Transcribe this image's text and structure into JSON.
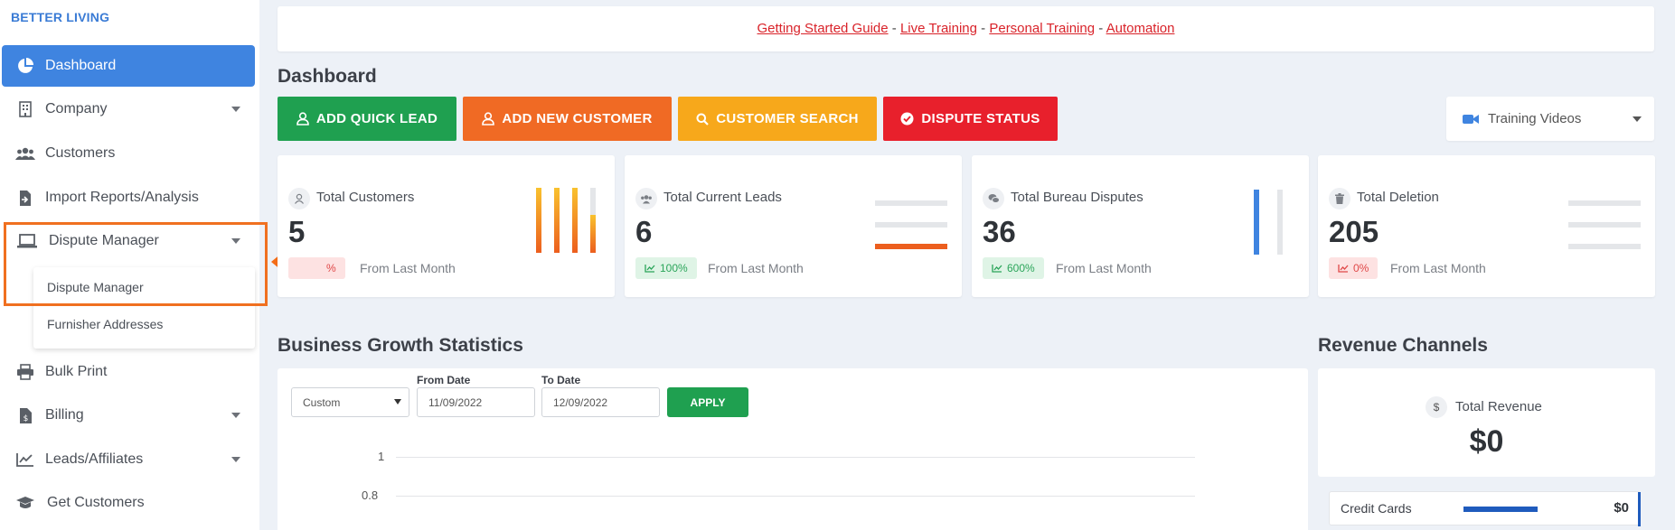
{
  "brand": "BETTER LIVING",
  "sidebar": {
    "items": [
      {
        "label": "Dashboard",
        "icon": "pie-chart-icon"
      },
      {
        "label": "Company",
        "icon": "building-icon"
      },
      {
        "label": "Customers",
        "icon": "users-icon"
      },
      {
        "label": "Import Reports/Analysis",
        "icon": "file-import-icon"
      },
      {
        "label": "Dispute Manager",
        "icon": "laptop-icon"
      },
      {
        "label": "Bulk Print",
        "icon": "printer-icon"
      },
      {
        "label": "Billing",
        "icon": "invoice-icon"
      },
      {
        "label": "Leads/Affiliates",
        "icon": "line-chart-icon"
      },
      {
        "label": "Get Customers",
        "icon": "graduation-cap-icon"
      }
    ],
    "submenu": [
      "Dispute Manager",
      "Furnisher Addresses"
    ]
  },
  "banner": {
    "links": [
      "Getting Started Guide",
      "Live Training",
      "Personal Training",
      "Automation"
    ],
    "separator": " - "
  },
  "page_title": "Dashboard",
  "actions": [
    {
      "label": "ADD QUICK LEAD",
      "color": "#1fa050"
    },
    {
      "label": "ADD NEW CUSTOMER",
      "color": "#f06a24"
    },
    {
      "label": "CUSTOMER SEARCH",
      "color": "#f7a81b"
    },
    {
      "label": "DISPUTE STATUS",
      "color": "#e8202c"
    }
  ],
  "training_videos": "Training Videos",
  "cards": [
    {
      "label": "Total Customers",
      "value": "5",
      "badge": "%",
      "foot": "From Last Month",
      "badge_type": "red"
    },
    {
      "label": "Total Current Leads",
      "value": "6",
      "badge": "100%",
      "foot": "From Last Month",
      "badge_type": "green"
    },
    {
      "label": "Total Bureau Disputes",
      "value": "36",
      "badge": "600%",
      "foot": "From Last Month",
      "badge_type": "green"
    },
    {
      "label": "Total Deletion",
      "value": "205",
      "badge": "0%",
      "foot": "From Last Month",
      "badge_type": "red"
    }
  ],
  "growth": {
    "title": "Business Growth Statistics",
    "range_select": "Custom",
    "from_label": "From Date",
    "from_value": "11/09/2022",
    "to_label": "To Date",
    "to_value": "12/09/2022",
    "apply": "APPLY",
    "yticks": [
      "1",
      "0.8"
    ]
  },
  "revenue": {
    "title": "Revenue Channels",
    "total_label": "Total Revenue",
    "total_value": "$0",
    "currency_symbol": "$",
    "row_label": "Credit Cards",
    "row_value": "$0"
  }
}
